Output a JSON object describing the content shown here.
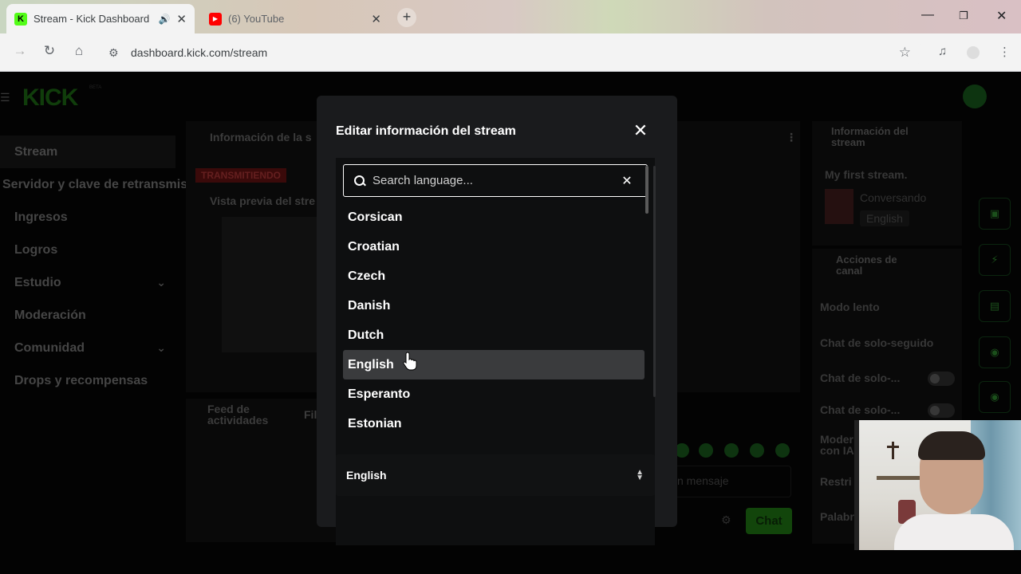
{
  "browser": {
    "tabs": [
      {
        "title": "Stream - Kick Dashboard",
        "favicon": "K",
        "active": true,
        "audio": true
      },
      {
        "title": "(6) YouTube",
        "favicon": "youtube-icon",
        "active": false
      }
    ],
    "url": "dashboard.kick.com/stream"
  },
  "app": {
    "logo": "KICK",
    "logo_badge": "BETA",
    "sidebar": [
      {
        "label": "Stream"
      },
      {
        "label": "Servidor y clave de retransmisión"
      },
      {
        "label": "Ingresos"
      },
      {
        "label": "Logros"
      },
      {
        "label": "Estudio",
        "expandable": true
      },
      {
        "label": "Moderación"
      },
      {
        "label": "Comunidad",
        "expandable": true
      },
      {
        "label": "Drops y recompensas"
      }
    ],
    "stream_info_panel_title": "Información de la s",
    "live_badge": "TRANSMITIENDO",
    "preview_title": "Vista previa del stre",
    "activity_feed_title": "Feed de actividades",
    "activity_filter": "Fil",
    "right_panel": {
      "info_title": "Información del stream",
      "stream_title": "My first stream.",
      "category": "Conversando",
      "language": "English",
      "channel_actions_title": "Acciones de canal",
      "slow_mode": "Modo lento",
      "followers_only": "Chat de solo-seguido",
      "sub_only_1": "Chat de solo-...",
      "sub_only_2": "Chat de solo-...",
      "ai_mod": "Moder con IA",
      "restrict": "Restri",
      "words": "Palabr"
    },
    "chat": {
      "input_placeholder": "n mensaje",
      "send_label": "Chat"
    }
  },
  "modal": {
    "title": "Editar información del stream",
    "search_placeholder": "Search language...",
    "languages": [
      "Corsican",
      "Croatian",
      "Czech",
      "Danish",
      "Dutch",
      "English",
      "Esperanto",
      "Estonian"
    ],
    "hovered_language": "English",
    "selected_value": "English"
  }
}
